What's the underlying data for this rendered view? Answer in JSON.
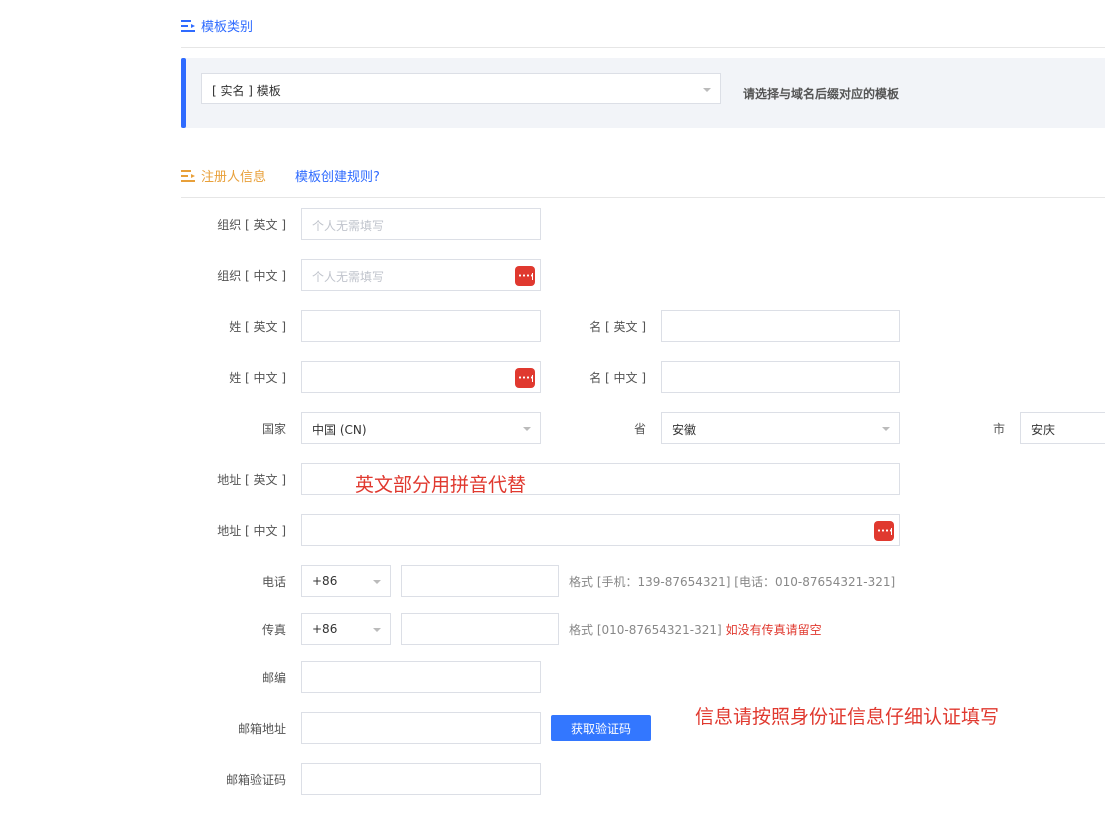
{
  "section_template": {
    "title": "模板类别",
    "select_value": "[ 实名 ] 模板",
    "hint": "请选择与域名后缀对应的模板"
  },
  "section_registrant": {
    "title": "注册人信息",
    "rules_link": "模板创建规则?"
  },
  "form": {
    "org_en": {
      "label": "组织 [ 英文 ]",
      "placeholder": "个人无需填写"
    },
    "org_cn": {
      "label": "组织 [ 中文 ]",
      "placeholder": "个人无需填写"
    },
    "last_en": {
      "label": "姓 [ 英文 ]"
    },
    "first_en": {
      "label": "名 [ 英文 ]"
    },
    "last_cn": {
      "label": "姓 [ 中文 ]"
    },
    "first_cn": {
      "label": "名 [ 中文 ]"
    },
    "country": {
      "label": "国家",
      "value": "中国 (CN)"
    },
    "province": {
      "label": "省",
      "value": "安徽"
    },
    "city": {
      "label": "市",
      "value": "安庆"
    },
    "addr_en": {
      "label": "地址 [ 英文 ]"
    },
    "addr_cn": {
      "label": "地址 [ 中文 ]"
    },
    "phone": {
      "label": "电话",
      "code": "+86",
      "format": "格式 [手机：139-87654321] [电话：010-87654321-321]"
    },
    "fax": {
      "label": "传真",
      "code": "+86",
      "format": "格式 [010-87654321-321]",
      "note": "如没有传真请留空"
    },
    "postcode": {
      "label": "邮编"
    },
    "email": {
      "label": "邮箱地址",
      "button": "获取验证码"
    },
    "email_code": {
      "label": "邮箱验证码"
    }
  },
  "annotations": {
    "pinyin": "英文部分用拼音代替",
    "id_info": "信息请按照身份证信息仔细认证填写"
  },
  "colors": {
    "accent_blue": "#2f6bff",
    "accent_orange": "#e8a03a",
    "red": "#e0392f"
  }
}
